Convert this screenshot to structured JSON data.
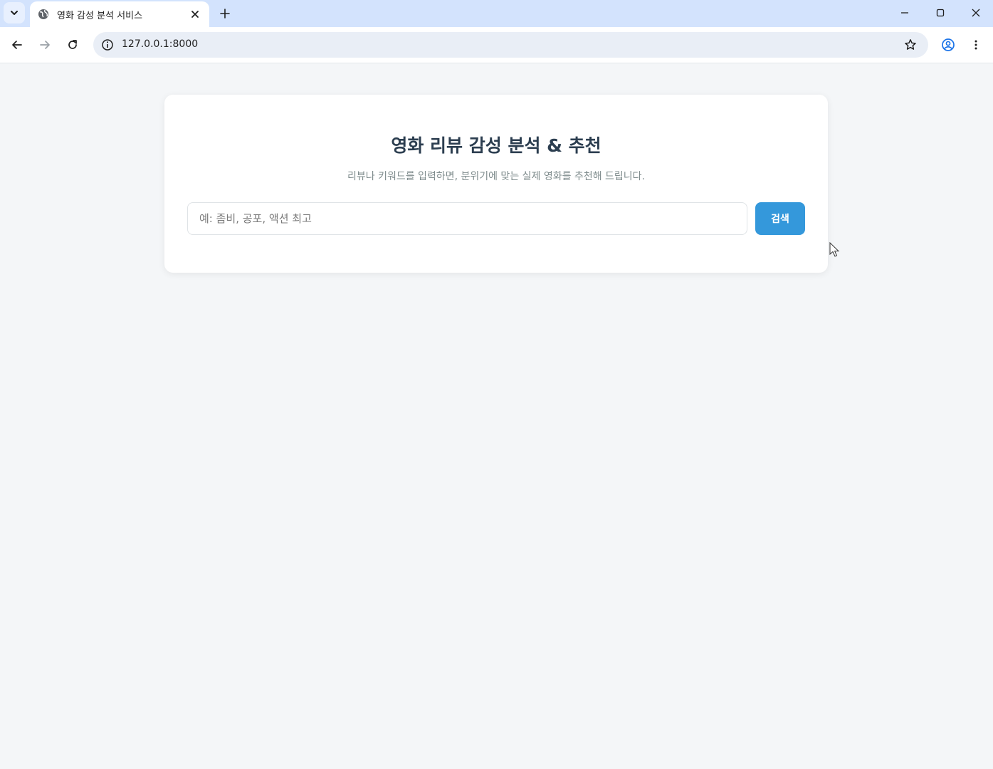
{
  "browser": {
    "tab_title": "영화 감성 분석 서비스",
    "url": "127.0.0.1:8000"
  },
  "page": {
    "title": "영화 리뷰 감성 분석 & 추천",
    "subtitle": "리뷰나 키워드를 입력하면, 분위기에 맞는 실제 영화를 추천해 드립니다.",
    "search_placeholder": "예: 좀비, 공포, 액션 최고",
    "search_value": "",
    "search_button_label": "검색"
  },
  "colors": {
    "accent": "#3498db",
    "title": "#2c3e50",
    "page_background": "#f4f6f8"
  }
}
